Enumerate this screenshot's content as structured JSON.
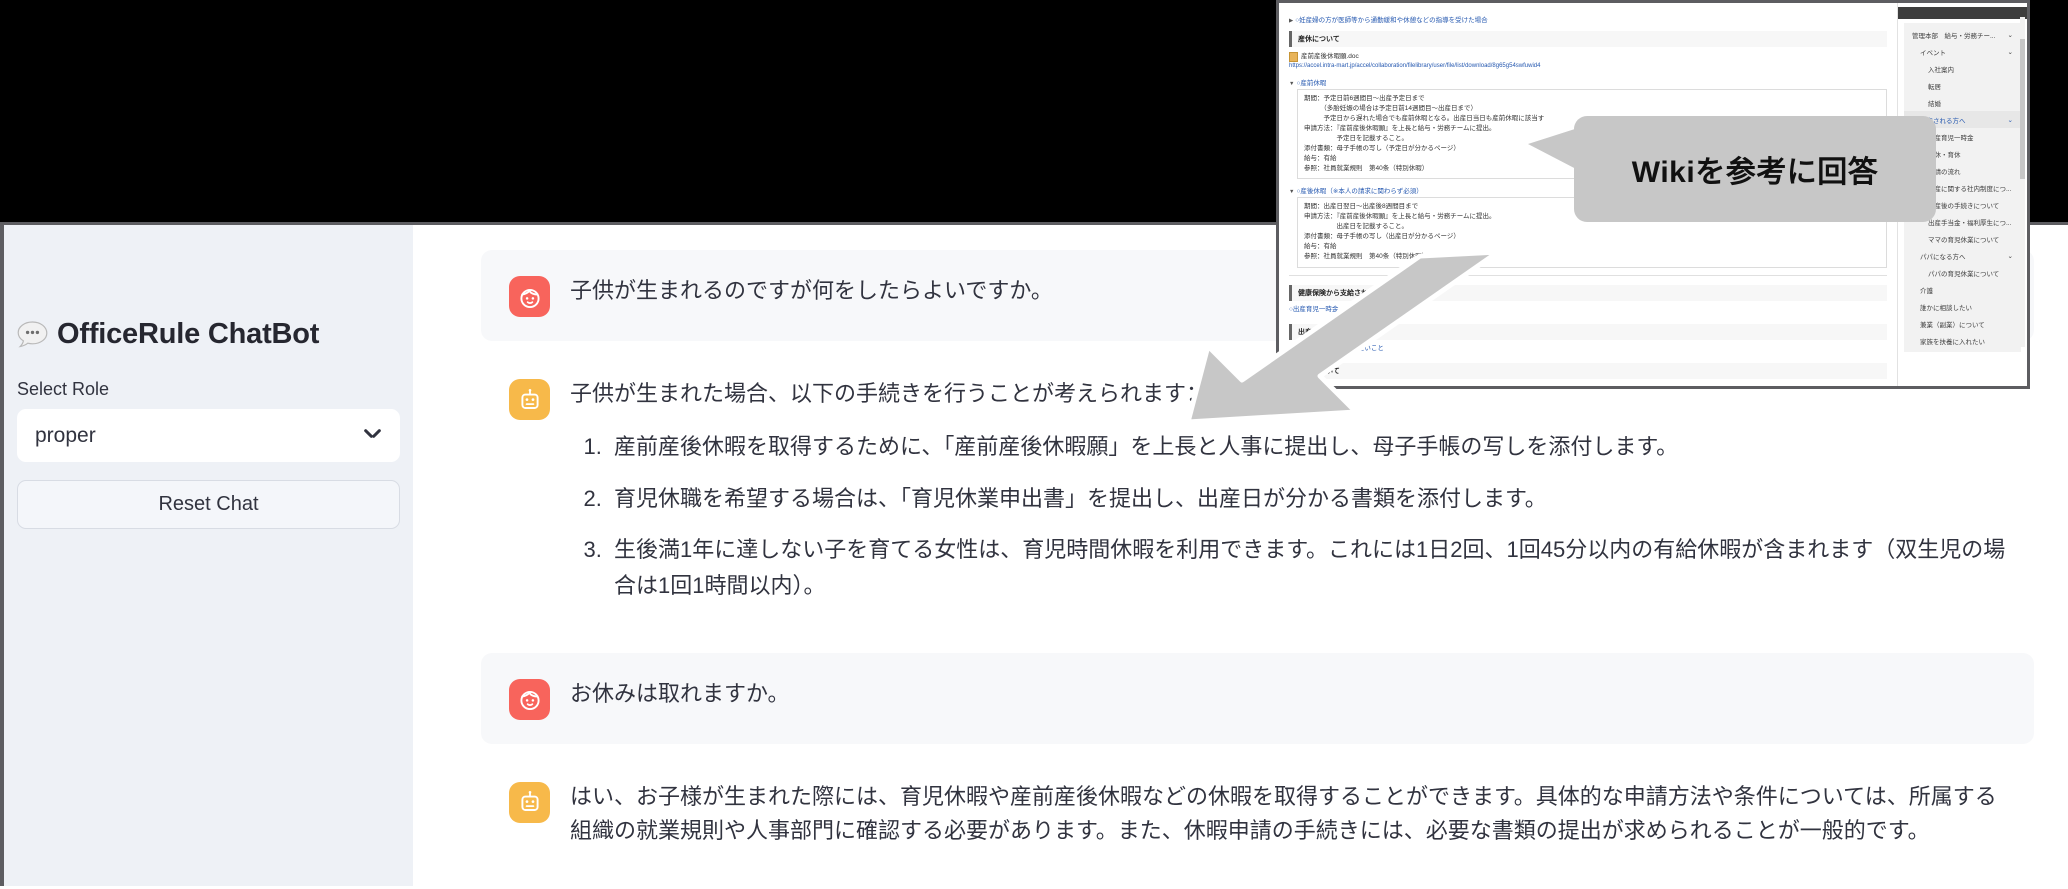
{
  "app": {
    "brand_icon": "chat-bubble-icon",
    "title": "OfficeRule ChatBot"
  },
  "sidebar": {
    "select_label": "Select Role",
    "select_value": "proper",
    "select_icon": "chevron-down-icon",
    "reset_button": "Reset Chat"
  },
  "chat": {
    "messages": [
      {
        "role": "user",
        "avatar_icon": "baby-face-icon",
        "text": "子供が生まれるのですが何をしたらよいですか。",
        "list": []
      },
      {
        "role": "bot",
        "avatar_icon": "robot-icon",
        "text": "子供が生まれた場合、以下の手続きを行うことが考えられます：",
        "list": [
          "産前産後休暇を取得するために、「産前産後休暇願」を上長と人事に提出し、母子手帳の写しを添付します。",
          "育児休職を希望する場合は、「育児休業申出書」を提出し、出産日が分かる書類を添付します。",
          "生後満1年に達しない子を育てる女性は、育児時間休暇を利用できます。これには1日2回、1回45分以内の有給休暇が含まれます（双生児の場合は1回1時間以内）。"
        ]
      },
      {
        "role": "user",
        "avatar_icon": "baby-face-icon",
        "text": "お休みは取れますか。",
        "list": []
      },
      {
        "role": "bot",
        "avatar_icon": "robot-icon",
        "text": "はい、お子様が生まれた際には、育児休暇や産前産後休暇などの休暇を取得することができます。具体的な申請方法や条件については、所属する組織の就業規則や人事部門に確認する必要があります。また、休暇申請の手続きには、必要な書類の提出が求められることが一般的です。",
        "list": []
      }
    ]
  },
  "callout": {
    "text": "Wikiを参考に回答"
  },
  "overlay": {
    "top_toggle": "○妊産婦の方が医師等から通勤緩和や休憩などの指導を受けた場合",
    "section1_heading": "産休について",
    "file_name": "産前産後休暇願.doc",
    "file_url": "https://accel.intra-mart.jp/accel/collaboration/filelibrary/user/file/list/download/8g65g54swfuwid4",
    "block1_toggle": "○産前休暇",
    "block1_lines": [
      "期間：予定日前6週間目〜出産予定日まで",
      "　　　（多胎妊娠の場合は予定日前14週間目〜出産日まで）",
      "　　　予定日から遅れた場合でも産前休暇となる。出産日当日も産前休暇に該当す",
      "申請方法：『産前産後休暇願』を上長と給与・労務チームに提出。",
      "　　　　　予定日を記載すること。",
      "添付書類：母子手帳の写し（予定日が分かるページ）",
      "給与：有給",
      "参照：社員就業規則　第40条（特別休暇）"
    ],
    "block2_toggle": "○産後休暇（※本人の請求に関わらず必須）",
    "block2_lines": [
      "期間：出産日翌日〜出産後8週間目まで",
      "申請方法：『産前産後休暇願』を上長と給与・労務チームに提出。",
      "　　　　　出産日を記載すること。",
      "添付書類：母子手帳の写し（出産日が分かるページ）",
      "給与：有給",
      "参照：社員就業規則　第40条（特別休暇）"
    ],
    "section2_heading": "健康保険から支給される給付金について",
    "link1": "○出産育児一時金",
    "section3_heading": "出産後",
    "link2": "○出産後ご対応いただきたいこと",
    "section4_heading": "育休について",
    "side_items": [
      {
        "label": "管理本部　給与・労務チー...",
        "indent": 0,
        "chevron": true,
        "highlight": false
      },
      {
        "label": "イベント",
        "indent": 1,
        "chevron": true,
        "highlight": false
      },
      {
        "label": "入社案内",
        "indent": 2,
        "chevron": false,
        "highlight": false
      },
      {
        "label": "転居",
        "indent": 2,
        "chevron": false,
        "highlight": false
      },
      {
        "label": "結婚",
        "indent": 2,
        "chevron": false,
        "highlight": false
      },
      {
        "label": "出産される方へ",
        "indent": 1,
        "chevron": true,
        "highlight": true
      },
      {
        "label": "出産育児一時金",
        "indent": 2,
        "chevron": false,
        "highlight": false
      },
      {
        "label": "産休・育休",
        "indent": 2,
        "chevron": false,
        "highlight": false
      },
      {
        "label": "申請の流れ",
        "indent": 2,
        "chevron": false,
        "highlight": false
      },
      {
        "label": "出産に関する社内制度につ...",
        "indent": 2,
        "chevron": false,
        "highlight": false
      },
      {
        "label": "出産後の手続きについて",
        "indent": 2,
        "chevron": false,
        "highlight": false
      },
      {
        "label": "出産手当金・福利厚生につ...",
        "indent": 2,
        "chevron": false,
        "highlight": false
      },
      {
        "label": "ママの育児休業について",
        "indent": 2,
        "chevron": false,
        "highlight": false
      },
      {
        "label": "パパになる方へ",
        "indent": 1,
        "chevron": true,
        "highlight": false
      },
      {
        "label": "パパの育児休業について",
        "indent": 2,
        "chevron": false,
        "highlight": false
      },
      {
        "label": "介護",
        "indent": 1,
        "chevron": false,
        "highlight": false
      },
      {
        "label": "誰かに相談したい",
        "indent": 1,
        "chevron": false,
        "highlight": false
      },
      {
        "label": "兼業（副業）について",
        "indent": 1,
        "chevron": false,
        "highlight": false
      },
      {
        "label": "家族を扶養に入れたい",
        "indent": 1,
        "chevron": false,
        "highlight": false
      }
    ]
  },
  "colors": {
    "user_accent": "#f8645c",
    "bot_accent": "#f7b94a",
    "sidebar_bg": "#eef1f6",
    "text": "#31333f",
    "callout_bg": "#c7c7c7",
    "link": "#2558b0"
  }
}
